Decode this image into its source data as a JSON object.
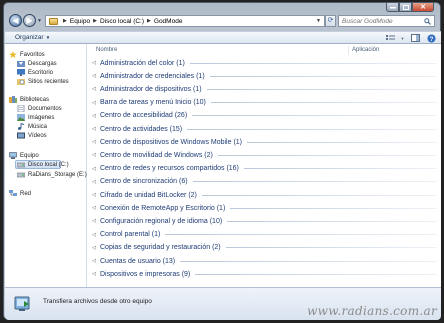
{
  "window": {
    "address": {
      "crumbs": [
        "Equipo",
        "Disco local (C:)",
        "GodMode"
      ]
    },
    "search": {
      "placeholder": "Buscar GodMode"
    }
  },
  "commandbar": {
    "organize_label": "Organizar",
    "views_icon": "views-icon",
    "preview_icon": "preview-pane-icon",
    "help_icon": "help-icon"
  },
  "nav_pane": {
    "favorites": {
      "label": "Favoritos",
      "items": [
        "Descargas",
        "Escritorio",
        "Sitios recientes"
      ]
    },
    "libraries": {
      "label": "Bibliotecas",
      "items": [
        "Documentos",
        "Imágenes",
        "Música",
        "Vídeos"
      ]
    },
    "computer": {
      "label": "Equipo",
      "items": [
        "Disco local (C:)",
        "RaDians_Storage (E:)"
      ]
    },
    "network": {
      "label": "Red"
    }
  },
  "file_pane": {
    "columns": {
      "name": "Nombre",
      "app": "Aplicación"
    },
    "groups": [
      "Administración del color (1)",
      "Administrador de credenciales (1)",
      "Administrador de dispositivos (1)",
      "Barra de tareas y menú Inicio (10)",
      "Centro de accesibilidad (26)",
      "Centro de actividades (15)",
      "Centro de dispositivos de Windows Mobile (1)",
      "Centro de movilidad de Windows (2)",
      "Centro de redes y recursos compartidos (16)",
      "Centro de sincronización (6)",
      "Cifrado de unidad BitLocker (2)",
      "Conexión de RemoteApp y Escritorio (1)",
      "Configuración regional y de idioma (10)",
      "Control parental (1)",
      "Copias de seguridad y restauración (2)",
      "Cuentas de usuario (13)",
      "Dispositivos e impresoras (9)"
    ]
  },
  "details": {
    "text": "Transfiera archivos desde otro equipo"
  },
  "watermark": "www.radians.com.ar",
  "colors": {
    "accent": "#1e3c75",
    "chrome": "#b9c3cf"
  }
}
